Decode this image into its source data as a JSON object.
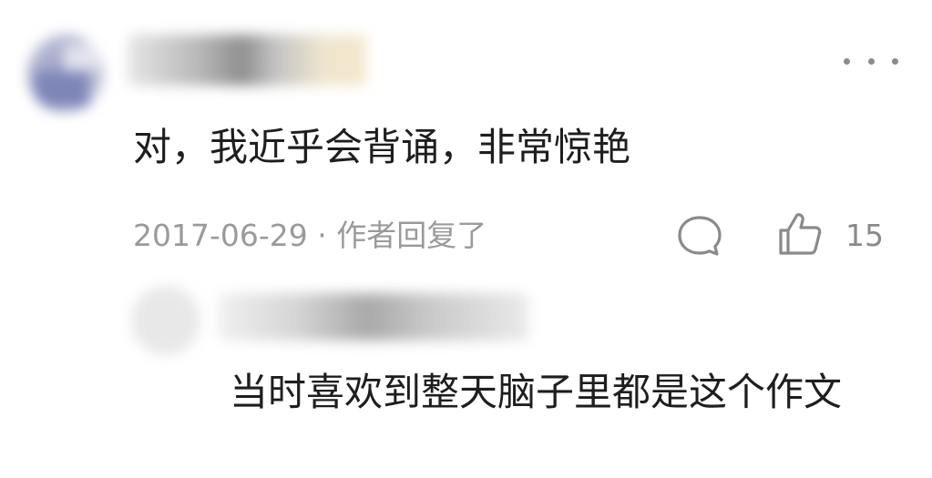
{
  "comment": {
    "text": "对，我近乎会背诵，非常惊艳",
    "date": "2017-06-29",
    "separator": " · ",
    "author_reply_label": "作者回复了",
    "like_count": "15",
    "icons": [
      "more-icon",
      "reply-icon",
      "like-icon"
    ]
  },
  "reply": {
    "text": "当时喜欢到整天脑子里都是这个作文"
  }
}
